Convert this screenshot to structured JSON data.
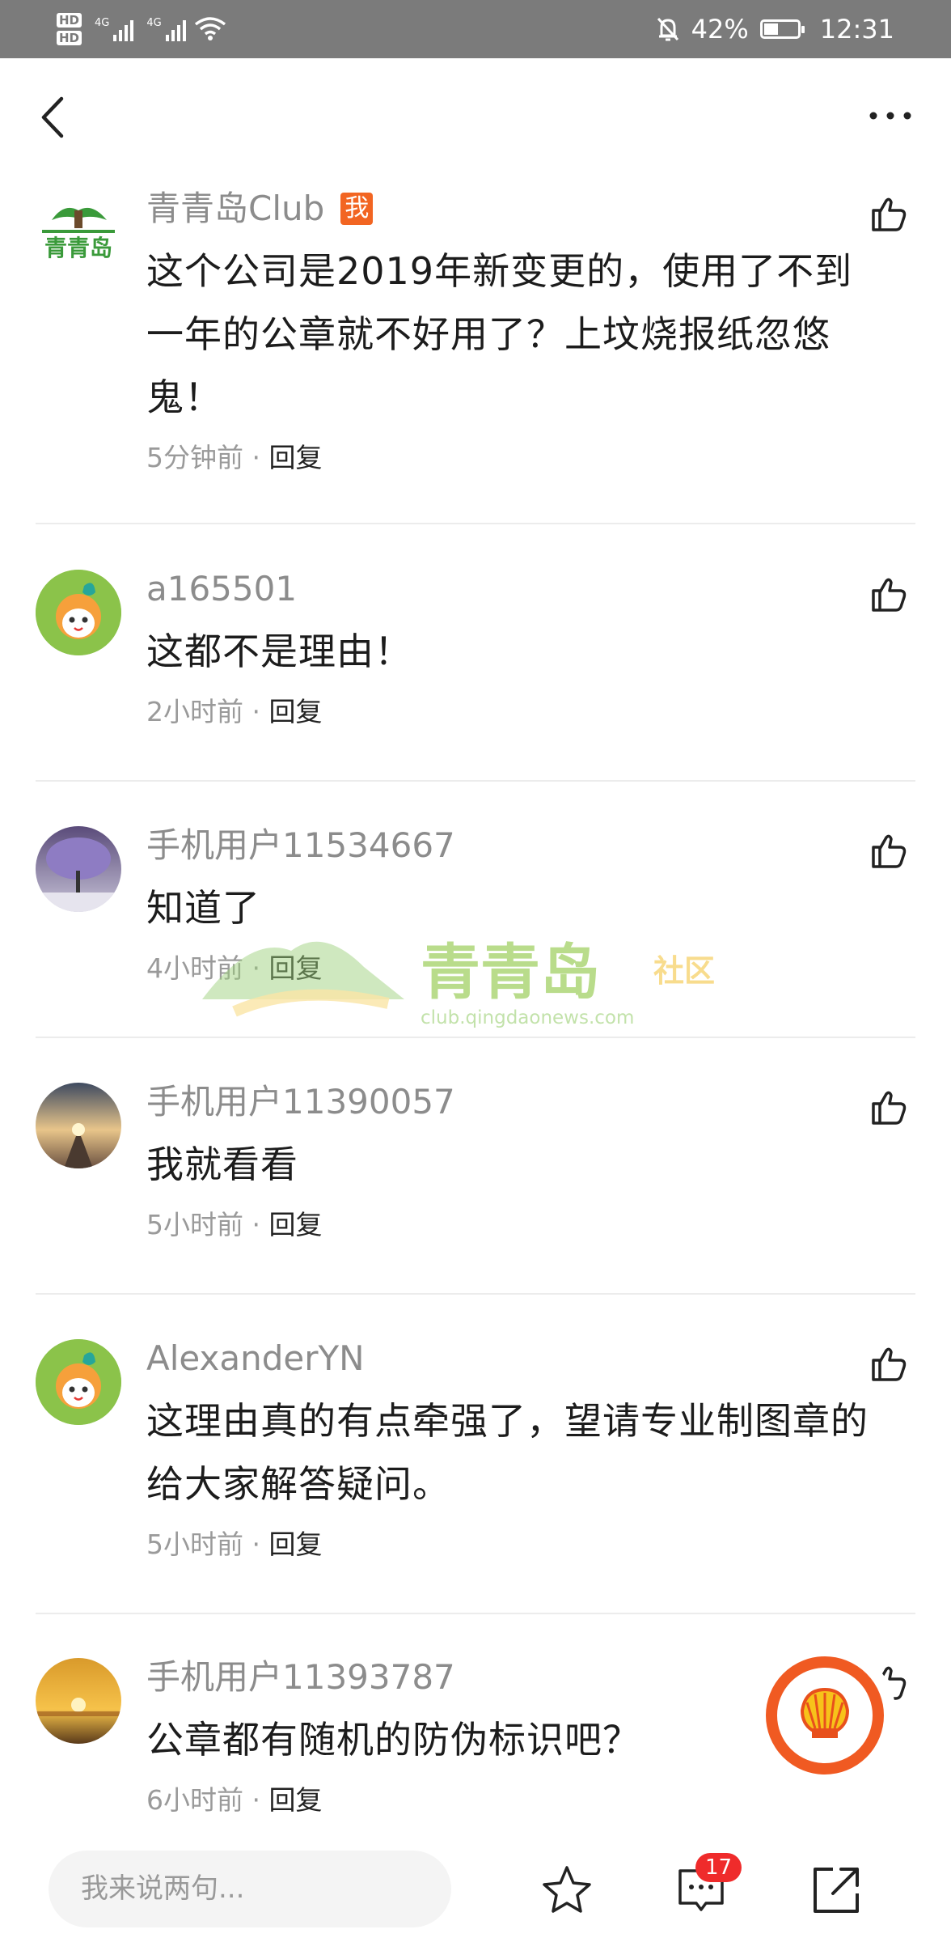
{
  "status_bar": {
    "hd1": "HD",
    "hd2": "HD",
    "net1": "4G",
    "net2": "4G",
    "battery_percent": "42%",
    "battery_level": 0.42,
    "time": "12:31"
  },
  "comments": [
    {
      "username": "青青岛Club",
      "badge": "我",
      "text": "这个公司是2019年新变更的，使用了不到一年的公章就不好用了？上坟烧报纸忽悠鬼！",
      "time": "5分钟前",
      "sep": " · ",
      "reply": "回复"
    },
    {
      "username": "a165501",
      "text": "这都不是理由！",
      "time": "2小时前",
      "sep": " · ",
      "reply": "回复"
    },
    {
      "username": "手机用户11534667",
      "text": "知道了",
      "time": "4小时前",
      "sep": " · ",
      "reply": "回复"
    },
    {
      "username": "手机用户11390057",
      "text": "我就看看",
      "time": "5小时前",
      "sep": " · ",
      "reply": "回复"
    },
    {
      "username": "AlexanderYN",
      "text": "这理由真的有点牵强了，望请专业制图章的给大家解答疑问。",
      "time": "5小时前",
      "sep": " · ",
      "reply": "回复"
    },
    {
      "username": "手机用户11393787",
      "text": "公章都有随机的防伪标识吧？",
      "time": "6小时前",
      "sep": " · ",
      "reply": "回复"
    }
  ],
  "watermark": {
    "title": "青青岛",
    "suffix": "社区",
    "url": "club.qingdaonews.com"
  },
  "bottom_bar": {
    "input_placeholder": "我来说两句...",
    "comment_count": "17"
  },
  "colors": {
    "badge_orange": "#f26522",
    "count_red": "#ef2b2b",
    "shell_red": "#e8501c",
    "watermark_green": "#8cc63f"
  },
  "logo_text": "青青岛"
}
